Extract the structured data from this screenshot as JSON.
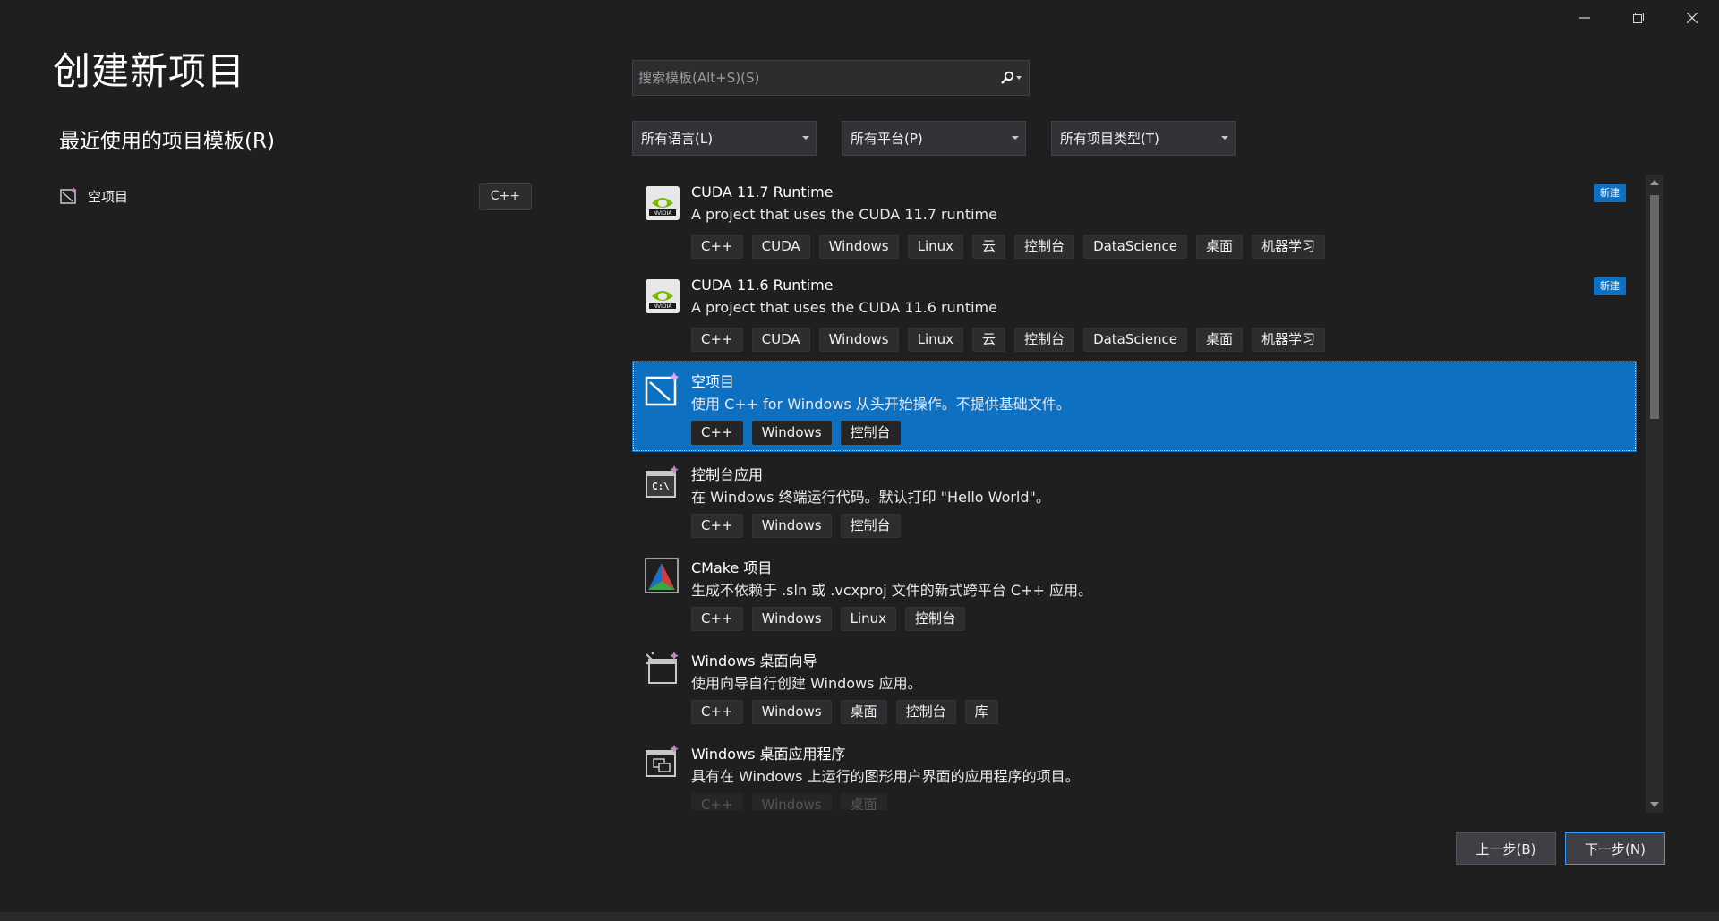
{
  "window": {
    "minimize_icon": "minimize-icon",
    "restore_icon": "restore-icon",
    "close_icon": "close-icon"
  },
  "header": {
    "title": "创建新项目"
  },
  "recent": {
    "heading": "最近使用的项目模板(R)",
    "items": [
      {
        "label": "空项目",
        "tag": "C++",
        "icon": "empty-project-icon"
      }
    ]
  },
  "search": {
    "placeholder": "搜索模板(Alt+S)(S)",
    "value": "",
    "icon": "search-icon"
  },
  "filters": {
    "language": "所有语言(L)",
    "platform": "所有平台(P)",
    "project_type": "所有项目类型(T)"
  },
  "templates": [
    {
      "title": "CUDA 11.7 Runtime",
      "description": "A project that uses the CUDA 11.7 runtime",
      "tags": [
        "C++",
        "CUDA",
        "Windows",
        "Linux",
        "云",
        "控制台",
        "DataScience",
        "桌面",
        "机器学习"
      ],
      "badge": "新建",
      "icon": "nvidia-icon"
    },
    {
      "title": "CUDA 11.6 Runtime",
      "description": "A project that uses the CUDA 11.6 runtime",
      "tags": [
        "C++",
        "CUDA",
        "Windows",
        "Linux",
        "云",
        "控制台",
        "DataScience",
        "桌面",
        "机器学习"
      ],
      "badge": "新建",
      "icon": "nvidia-icon"
    },
    {
      "title": "空项目",
      "description": "使用 C++ for Windows 从头开始操作。不提供基础文件。",
      "tags": [
        "C++",
        "Windows",
        "控制台"
      ],
      "selected": true,
      "icon": "empty-project-icon"
    },
    {
      "title": "控制台应用",
      "description": "在 Windows 终端运行代码。默认打印 \"Hello World\"。",
      "tags": [
        "C++",
        "Windows",
        "控制台"
      ],
      "icon": "console-app-icon"
    },
    {
      "title": "CMake 项目",
      "description": "生成不依赖于 .sln 或 .vcxproj 文件的新式跨平台 C++ 应用。",
      "tags": [
        "C++",
        "Windows",
        "Linux",
        "控制台"
      ],
      "icon": "cmake-icon"
    },
    {
      "title": "Windows 桌面向导",
      "description": "使用向导自行创建 Windows 应用。",
      "tags": [
        "C++",
        "Windows",
        "桌面",
        "控制台",
        "库"
      ],
      "icon": "desktop-wizard-icon"
    },
    {
      "title": "Windows 桌面应用程序",
      "description": "具有在 Windows 上运行的图形用户界面的应用程序的项目。",
      "tags": [
        "C++",
        "Windows",
        "桌面"
      ],
      "icon": "desktop-app-icon"
    }
  ],
  "buttons": {
    "back": "上一步(B)",
    "next": "下一步(N)"
  },
  "colors": {
    "accent": "#0e70c0",
    "background": "#1f1f1f"
  }
}
